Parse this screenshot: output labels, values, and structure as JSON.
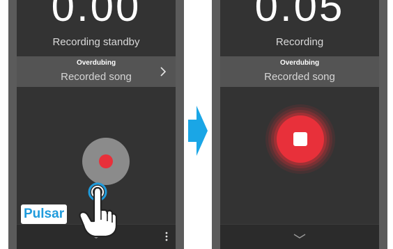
{
  "left_screen": {
    "time": "0.00",
    "status": "Recording standby",
    "band_title": "Overdubing",
    "band_song": "Recorded song"
  },
  "right_screen": {
    "time": "0.05",
    "status": "Recording",
    "band_title": "Overdubing",
    "band_song": "Recorded song"
  },
  "callout": {
    "label": "Pulsar"
  },
  "colors": {
    "record_red": "#e8303a",
    "arrow_blue": "#1aa6e6",
    "callout_blue": "#1f9bdc"
  },
  "icons": {
    "record": "record-icon",
    "stop": "stop-icon",
    "next": "chevron-right-icon",
    "collapse": "chevron-down-icon",
    "menu": "kebab-menu-icon",
    "transition": "arrow-right-icon",
    "tap": "hand-tap-icon"
  }
}
